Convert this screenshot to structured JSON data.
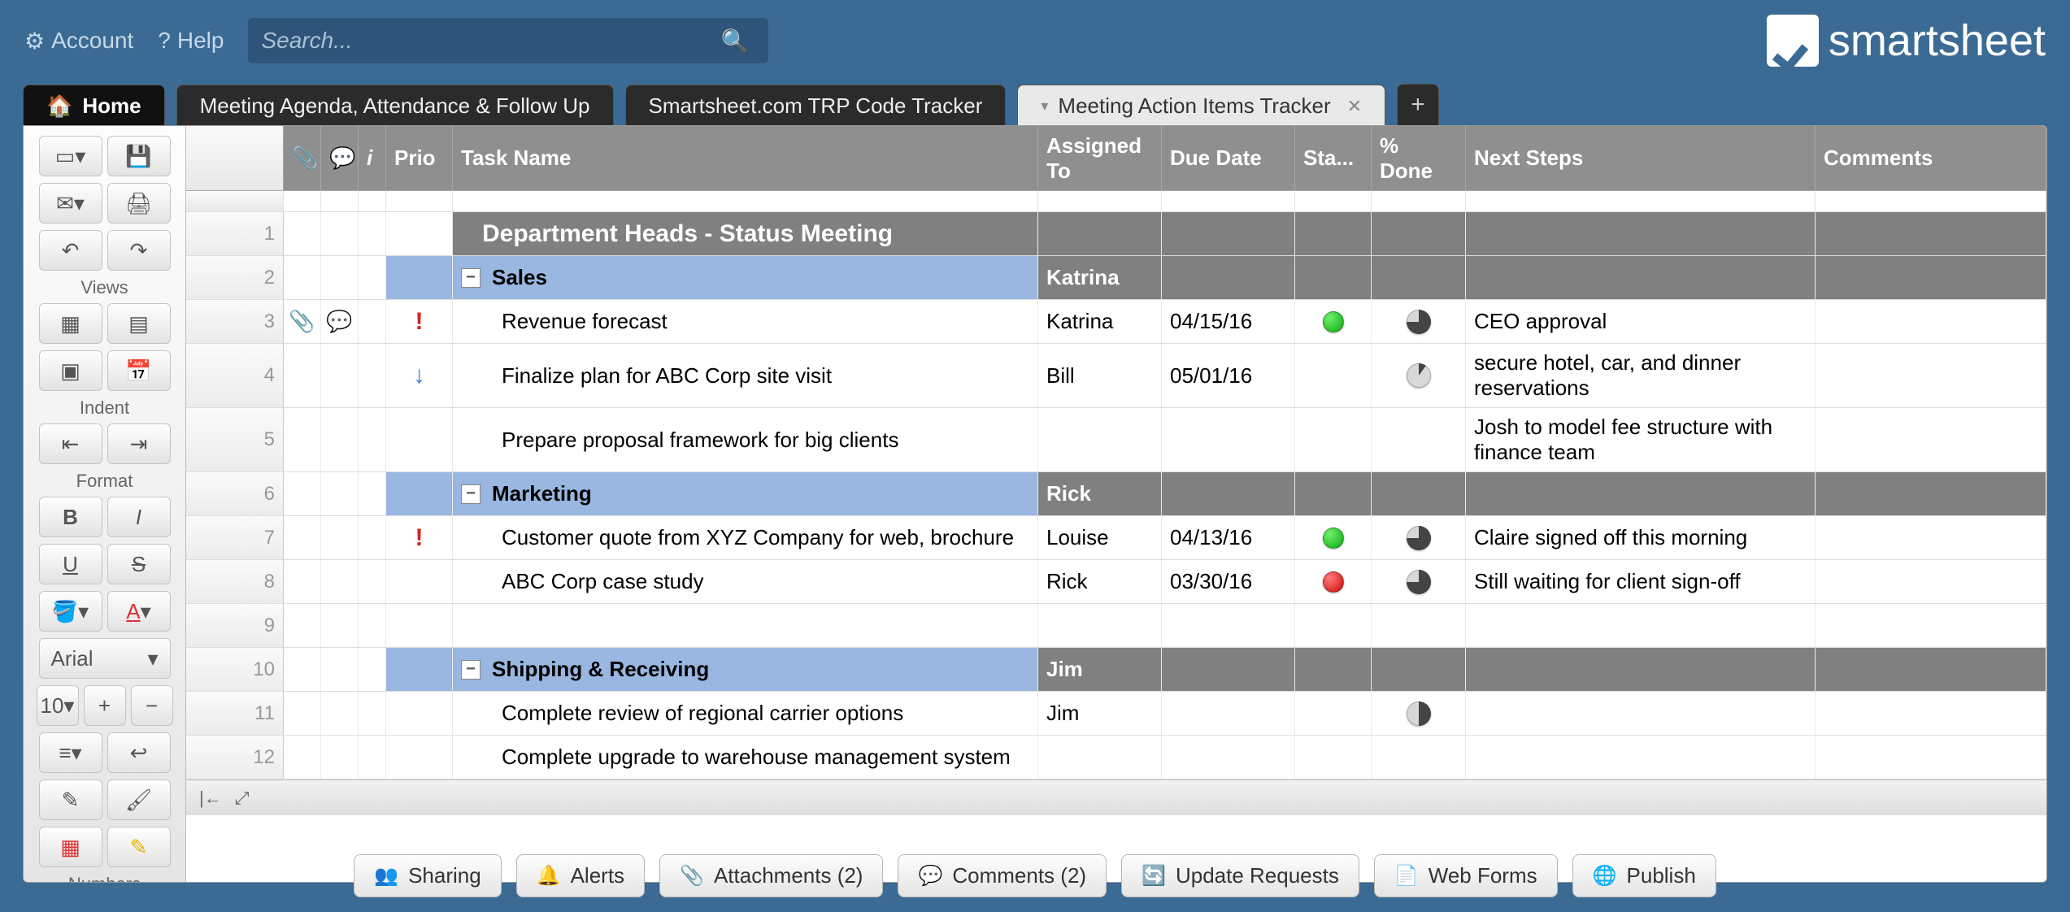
{
  "topbar": {
    "account": "Account",
    "help": "Help",
    "search_placeholder": "Search..."
  },
  "brand": "smartsheet",
  "tabs": {
    "home": "Home",
    "t1": "Meeting Agenda, Attendance & Follow Up",
    "t2": "Smartsheet.com TRP Code Tracker",
    "t3": "Meeting Action Items Tracker"
  },
  "lefttool": {
    "views": "Views",
    "indent": "Indent",
    "format": "Format",
    "font": "Arial",
    "size": "10",
    "numbers": "Numbers"
  },
  "columns": {
    "prio": "Prio",
    "task": "Task Name",
    "assigned": "Assigned To",
    "due": "Due Date",
    "status": "Sta...",
    "pct": "% Done",
    "next": "Next Steps",
    "comments": "Comments"
  },
  "rows": [
    {
      "n": "1",
      "type": "title",
      "task": "Department Heads - Status Meeting"
    },
    {
      "n": "2",
      "type": "group",
      "task": "Sales",
      "assigned": "Katrina"
    },
    {
      "n": "3",
      "type": "item",
      "prio": "!",
      "prioClass": "prio-high",
      "attach": true,
      "comment": true,
      "task": "Revenue forecast",
      "assigned": "Katrina",
      "due": "04/15/16",
      "status": "green",
      "pct": "75",
      "next": "CEO approval"
    },
    {
      "n": "4",
      "type": "item",
      "prio": "↓",
      "prioClass": "prio-low",
      "task": "Finalize plan for ABC Corp site visit",
      "assigned": "Bill",
      "due": "05/01/16",
      "pct": "10",
      "next": "secure hotel, car, and dinner reservations"
    },
    {
      "n": "5",
      "type": "item",
      "task": "Prepare proposal framework for big clients",
      "next": "Josh to model fee structure with finance team"
    },
    {
      "n": "6",
      "type": "group",
      "task": "Marketing",
      "assigned": "Rick"
    },
    {
      "n": "7",
      "type": "item",
      "prio": "!",
      "prioClass": "prio-high",
      "task": "Customer quote from XYZ Company for web, brochure",
      "assigned": "Louise",
      "due": "04/13/16",
      "status": "green",
      "pct": "75",
      "next": "Claire signed off this morning"
    },
    {
      "n": "8",
      "type": "item",
      "task": "ABC Corp case study",
      "assigned": "Rick",
      "due": "03/30/16",
      "status": "red",
      "pct": "75",
      "next": "Still waiting for client sign-off"
    },
    {
      "n": "9",
      "type": "item"
    },
    {
      "n": "10",
      "type": "group",
      "task": "Shipping & Receiving",
      "assigned": "Jim"
    },
    {
      "n": "11",
      "type": "item",
      "task": "Complete review of regional carrier options",
      "assigned": "Jim",
      "pct": "50"
    },
    {
      "n": "12",
      "type": "item",
      "task": "Complete upgrade to warehouse management system"
    }
  ],
  "bottom": {
    "sharing": "Sharing",
    "alerts": "Alerts",
    "attachments": "Attachments  (2)",
    "comments": "Comments  (2)",
    "updates": "Update Requests",
    "webforms": "Web Forms",
    "publish": "Publish"
  }
}
